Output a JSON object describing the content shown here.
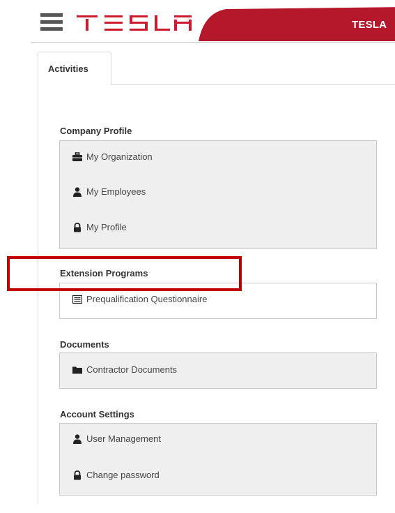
{
  "header": {
    "menu_icon": "hamburger-menu-icon",
    "logo_icon": "tesla-logo-icon",
    "brand_text": "TESLA",
    "accent_color": "#b5172b"
  },
  "tabs": [
    {
      "label": "Activities",
      "active": true
    }
  ],
  "sections": [
    {
      "title": "Company Profile",
      "items": [
        {
          "label": "My Organization",
          "icon": "briefcase-icon"
        },
        {
          "label": "My Employees",
          "icon": "user-icon"
        },
        {
          "label": "My Profile",
          "icon": "lock-icon"
        }
      ]
    },
    {
      "title": "Extension Programs",
      "items": [
        {
          "label": "Prequalification Questionnaire",
          "icon": "list-icon"
        }
      ]
    },
    {
      "title": "Documents",
      "items": [
        {
          "label": "Contractor Documents",
          "icon": "folder-icon"
        }
      ]
    },
    {
      "title": "Account Settings",
      "items": [
        {
          "label": "User Management",
          "icon": "user-icon"
        },
        {
          "label": "Change password",
          "icon": "lock-icon"
        }
      ]
    }
  ],
  "highlight_color": "#c00000"
}
